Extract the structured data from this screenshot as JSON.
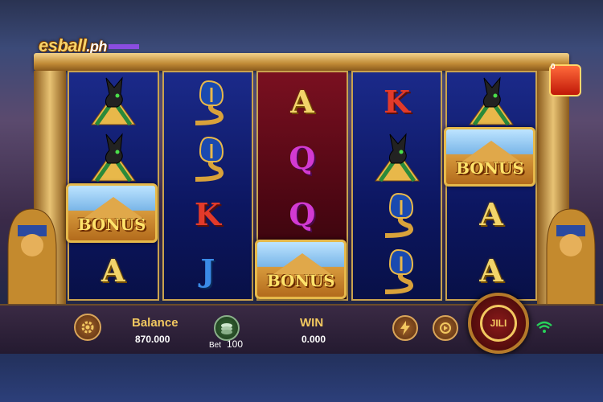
{
  "watermark": {
    "brand": "esball",
    "suffix": ".ph"
  },
  "jackpot": {
    "count": "0"
  },
  "reels": [
    [
      "anubis",
      "anubis",
      "bonus",
      "A"
    ],
    [
      "cobra",
      "cobra",
      "K",
      "J"
    ],
    [
      "A",
      "Q",
      "Q",
      "bonus"
    ],
    [
      "K",
      "anubis",
      "cobra",
      "cobra"
    ],
    [
      "anubis",
      "bonus",
      "A",
      "A"
    ]
  ],
  "bonus_label": "BONUS",
  "status_bar": {
    "balance_label": "Balance",
    "balance_value": "870.000",
    "bet_label": "Bet",
    "bet_value": "100",
    "win_label": "WIN",
    "win_value": "0.000",
    "spin_logo": "JILI"
  },
  "colors": {
    "accent_gold": "#f2c860",
    "reel_blue": "#0c1660",
    "reel_red": "#4a0612"
  },
  "icons": [
    "gear-icon",
    "chips-icon",
    "turbo-icon",
    "autoplay-icon",
    "wifi-icon",
    "jackpot-chest-icon"
  ]
}
